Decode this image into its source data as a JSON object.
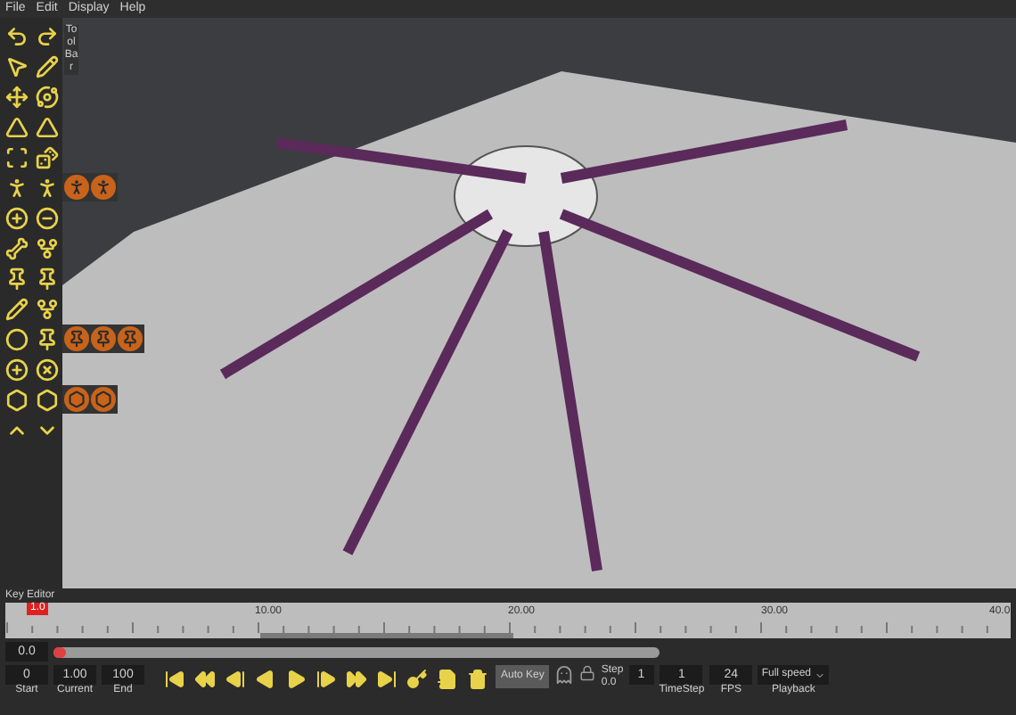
{
  "menu": [
    {
      "label": "File"
    },
    {
      "label": "Edit"
    },
    {
      "label": "Display"
    },
    {
      "label": "Help"
    }
  ],
  "toolbar": {
    "title": "Tool Bar"
  },
  "key_editor": {
    "title": "Key Editor",
    "playhead": "1.0",
    "ruler_labels": [
      "10.00",
      "20.00",
      "30.00",
      "40.0"
    ],
    "range_field": "0.0",
    "scrub": {
      "level": 0.02
    }
  },
  "frame_fields": [
    {
      "label": "Start",
      "value": "0"
    },
    {
      "label": "Current",
      "value": "1.00"
    },
    {
      "label": "End",
      "value": "100"
    }
  ],
  "auto_key": {
    "label": "Auto Key",
    "on": false
  },
  "step": {
    "label": "Step",
    "sub": "0.0",
    "value": "1"
  },
  "settings": [
    {
      "label": "TimeStep",
      "value": "1"
    },
    {
      "label": "FPS",
      "value": "24"
    }
  ],
  "playback": {
    "label": "Playback",
    "value": "Full speed"
  }
}
